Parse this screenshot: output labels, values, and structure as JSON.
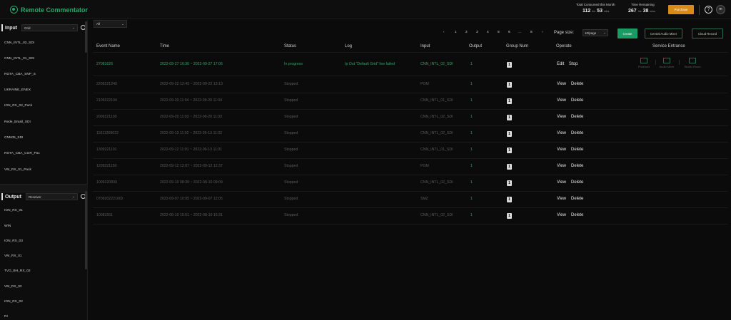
{
  "app": {
    "name": "Remote Commentator",
    "accent": "#2ea36b",
    "stats": {
      "consumed_label": "Total Consumed this Month",
      "consumed_hours": "112",
      "consumed_hours_unit": "hrs",
      "consumed_mins": "53",
      "consumed_mins_unit": "mins",
      "remaining_label": "Time Remaining",
      "remaining_hours": "267",
      "remaining_hours_unit": "hrs",
      "remaining_mins": "38",
      "remaining_mins_unit": "mins"
    },
    "purchase_label": "Purchase",
    "help_icon_text": "?",
    "avatar_initials": "m"
  },
  "sidebar": {
    "input_title": "Input",
    "input_filter": "Grid",
    "inputs": [
      "CNN_INTL_02_SDI",
      "CNN_INTL_01_SDI",
      "ROTA_CBA_SNP_S",
      "UKRAINE_ENEX",
      "ION_RX_02_Pack",
      "Rede_Brasil_SDI",
      "CNN05_SDI",
      "ROTA_CBA_CGR_Pac",
      "VM_RX_01_Pack"
    ],
    "output_title": "Output",
    "output_filter": "Receiver",
    "outputs": [
      "ION_RX_01",
      "WIN",
      "ION_RX_03",
      "VM_RX_01",
      "TVG_BH_RX_02",
      "VM_RX_02",
      "ION_RX_02",
      "RI"
    ]
  },
  "main": {
    "status_filter": "All",
    "pagination": {
      "prev": "‹",
      "pages": [
        "1",
        "2",
        "3",
        "4",
        "5",
        "6",
        "...",
        "8"
      ],
      "next": "›",
      "page_size_label": "Page size:",
      "page_size_value": "10/page"
    },
    "buttons": {
      "create": "Create",
      "central_audio_mixer": "Central Audio Mixer",
      "cloud_record": "Cloud Record"
    },
    "columns": [
      "Event Name",
      "Time",
      "Status",
      "Log",
      "Input",
      "Output",
      "Group Num",
      "Operate",
      "Service Entrance"
    ],
    "service_entrances": [
      "Producer",
      "Audio Mixer",
      "Studio Room"
    ],
    "rows": [
      {
        "event": "27081626",
        "time": "2022-09-27 16:36 ~ 2022-09-27 17:06",
        "status": "In progress",
        "log": "Ip Out \"Default Grid\" live failed",
        "input": "CNN_INTL_02_SDI",
        "output": "1",
        "group": "1",
        "ops": [
          "Edit",
          "Stop"
        ],
        "active": true
      },
      {
        "event": "2209221240",
        "time": "2022-09-22 12:43 ~ 2022-09-22 13:13",
        "status": "Stopped",
        "log": "",
        "input": "PGM",
        "output": "1",
        "group": "1",
        "ops": [
          "View",
          "Delete"
        ],
        "active": false
      },
      {
        "event": "2109222104",
        "time": "2022-09-20 11:04 ~ 2022-09-20 11:34",
        "status": "Stopped",
        "log": "",
        "input": "CNN_INTL_01_SDI",
        "output": "1",
        "group": "1",
        "ops": [
          "View",
          "Delete"
        ],
        "active": false
      },
      {
        "event": "2009221103",
        "time": "2022-09-20 11:03 ~ 2022-09-20 11:33",
        "status": "Stopped",
        "log": "",
        "input": "CNN_INTL_02_SDI",
        "output": "1",
        "group": "1",
        "ops": [
          "View",
          "Delete"
        ],
        "active": false
      },
      {
        "event": "11011309022",
        "time": "2022-09-13 11:02 ~ 2022-09-13 11:32",
        "status": "Stopped",
        "log": "",
        "input": "CNN_INTL_02_SDI",
        "output": "1",
        "group": "1",
        "ops": [
          "View",
          "Delete"
        ],
        "active": false
      },
      {
        "event": "1309221101",
        "time": "2022-09-12 11:01 ~ 2022-09-13 11:31",
        "status": "Stopped",
        "log": "",
        "input": "CNN_INTL_01_SDI",
        "output": "1",
        "group": "1",
        "ops": [
          "View",
          "Delete"
        ],
        "active": false
      },
      {
        "event": "1209221150",
        "time": "2022-09-12 12:07 ~ 2022-09-12 12:37",
        "status": "Stopped",
        "log": "",
        "input": "PGM",
        "output": "1",
        "group": "1",
        "ops": [
          "View",
          "Delete"
        ],
        "active": false
      },
      {
        "event": "1009220839",
        "time": "2022-09-10 08:39 ~ 2022-09-10 09:09",
        "status": "Stopped",
        "log": "",
        "input": "CNN_INTL_02_SDI",
        "output": "1",
        "group": "1",
        "ops": [
          "View",
          "Delete"
        ],
        "active": false
      },
      {
        "event": "0709202221002",
        "time": "2022-09-07 10:05 ~ 2022-09-07 12:05",
        "status": "Stopped",
        "log": "",
        "input": "SMZ",
        "output": "1",
        "group": "1",
        "ops": [
          "View",
          "Delete"
        ],
        "active": false
      },
      {
        "event": "10081551",
        "time": "2022-08-10 15:51 ~ 2022-08-10 16:31",
        "status": "Stopped",
        "log": "",
        "input": "CNN_INTL_02_SDI",
        "output": "1",
        "group": "1",
        "ops": [
          "View",
          "Delete"
        ],
        "active": false
      }
    ]
  }
}
